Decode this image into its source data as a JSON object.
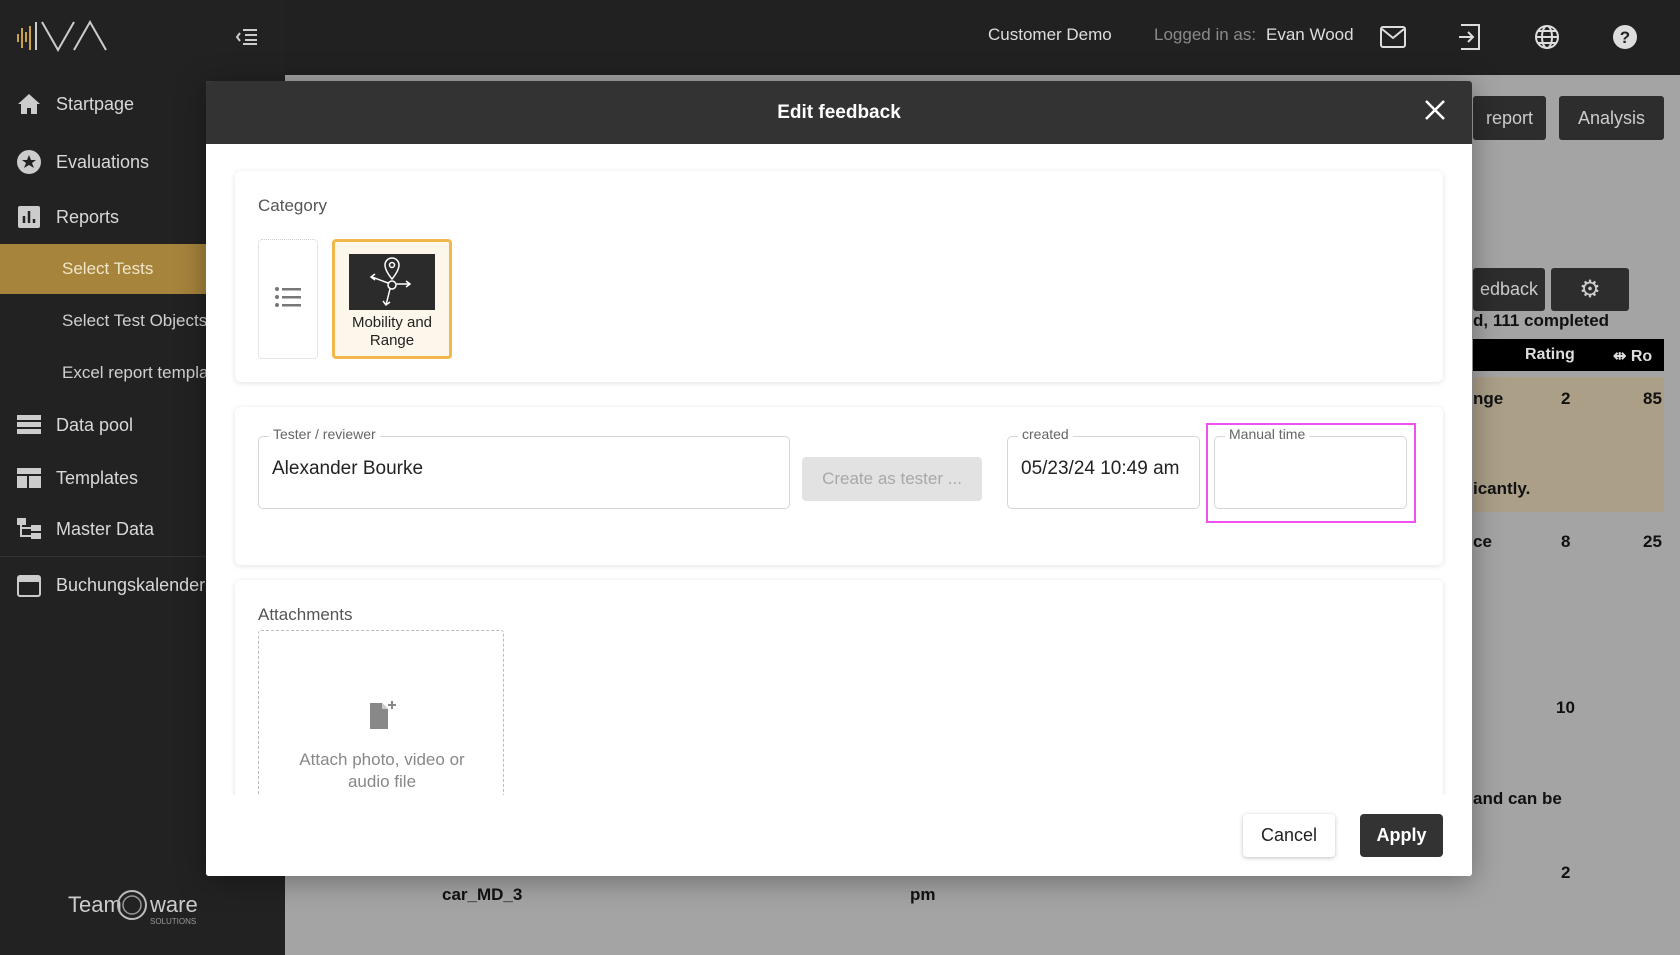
{
  "topbar": {
    "customer": "Customer Demo",
    "logged_in_label": "Logged in as:",
    "user": "Evan Wood",
    "icons": [
      "mail-icon",
      "logout-icon",
      "globe-icon",
      "help-icon"
    ]
  },
  "sidebar": {
    "items": [
      {
        "label": "Startpage",
        "icon": "home-icon"
      },
      {
        "label": "Evaluations",
        "icon": "star-icon"
      },
      {
        "label": "Reports",
        "icon": "bar-chart-icon"
      },
      {
        "label": "Data pool",
        "icon": "database-icon"
      },
      {
        "label": "Templates",
        "icon": "template-icon"
      },
      {
        "label": "Master Data",
        "icon": "hierarchy-icon"
      },
      {
        "label": "Buchungskalender",
        "icon": "calendar-icon"
      }
    ],
    "subitems": [
      {
        "label": "Select Tests",
        "active": true
      },
      {
        "label": "Select Test Objects"
      },
      {
        "label": "Excel report templates"
      }
    ],
    "footer_logo": "Team ware SOLUTIONS"
  },
  "background": {
    "report_btn": "report",
    "analysis_btn": "Analysis",
    "feedback_btn": "edback",
    "completed": "d, 111 completed",
    "col_rating": "Rating",
    "col_ro": "Ro",
    "cells": [
      "nge",
      "2",
      "85",
      "icantly.",
      "ce",
      "8",
      "25",
      "10",
      "and can be",
      "2",
      "car_MD_3",
      "pm"
    ]
  },
  "modal": {
    "title": "Edit feedback",
    "category_label": "Category",
    "category_selected": "Mobility and Range",
    "tester_label": "Tester / reviewer",
    "tester_value": "Alexander Bourke",
    "create_tester_btn": "Create as tester ...",
    "created_label": "created",
    "created_value": "05/23/24 10:49 am",
    "manual_time_label": "Manual time",
    "manual_time_value": "",
    "attachments_label": "Attachments",
    "attach_hint": "Attach photo, video or audio file",
    "cancel": "Cancel",
    "apply": "Apply",
    "highlight_color": "#f050f0",
    "selected_color": "#f0b84a"
  }
}
